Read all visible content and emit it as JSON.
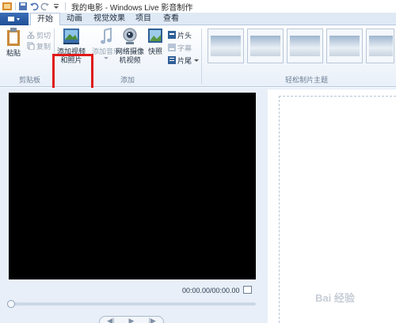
{
  "window": {
    "title": "我的电影 - Windows Live 影音制作"
  },
  "tabs": [
    {
      "label": "开始"
    },
    {
      "label": "动画"
    },
    {
      "label": "视觉效果"
    },
    {
      "label": "项目"
    },
    {
      "label": "查看"
    }
  ],
  "ribbon": {
    "clipboard": {
      "paste": "粘贴",
      "cut": "剪切",
      "copy": "复制",
      "group": "剪贴板"
    },
    "add": {
      "add_video_line1": "添加视频",
      "add_video_line2": "和照片",
      "add_music": "添加音乐",
      "webcam_line1": "网络摄像",
      "webcam_line2": "机视频",
      "snapshot": "快照",
      "title_card": "片头",
      "caption": "字幕",
      "credits": "片尾",
      "group": "添加"
    },
    "themes": {
      "group": "轻松制片主题"
    }
  },
  "player": {
    "timecode": "00:00.00/00:00.00"
  },
  "watermark": "Bai 经验"
}
